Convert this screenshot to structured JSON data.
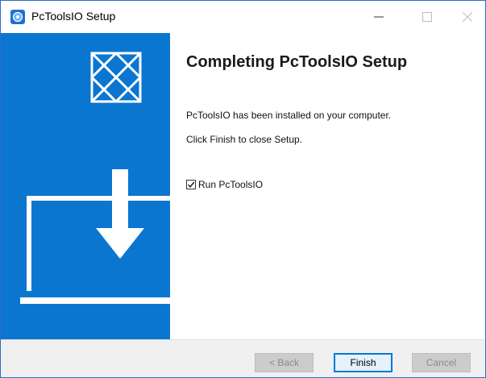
{
  "window": {
    "title": "PcToolsIO Setup",
    "controls": {
      "minimize": "minimize-icon",
      "maximize": "maximize-icon",
      "close": "close-icon"
    }
  },
  "sidebar": {
    "logo_icon": "envelope-pattern-logo",
    "illustration_icon": "download-to-laptop-icon",
    "background_color": "#0a76d0"
  },
  "content": {
    "heading": "Completing PcToolsIO Setup",
    "line1": "PcToolsIO has been installed on your computer.",
    "line2": "Click Finish to close Setup.",
    "run_checkbox": {
      "label": "Run PcToolsIO",
      "checked": true
    }
  },
  "footer": {
    "back_label": "< Back",
    "finish_label": "Finish",
    "cancel_label": "Cancel",
    "back_enabled": false,
    "cancel_enabled": false
  }
}
